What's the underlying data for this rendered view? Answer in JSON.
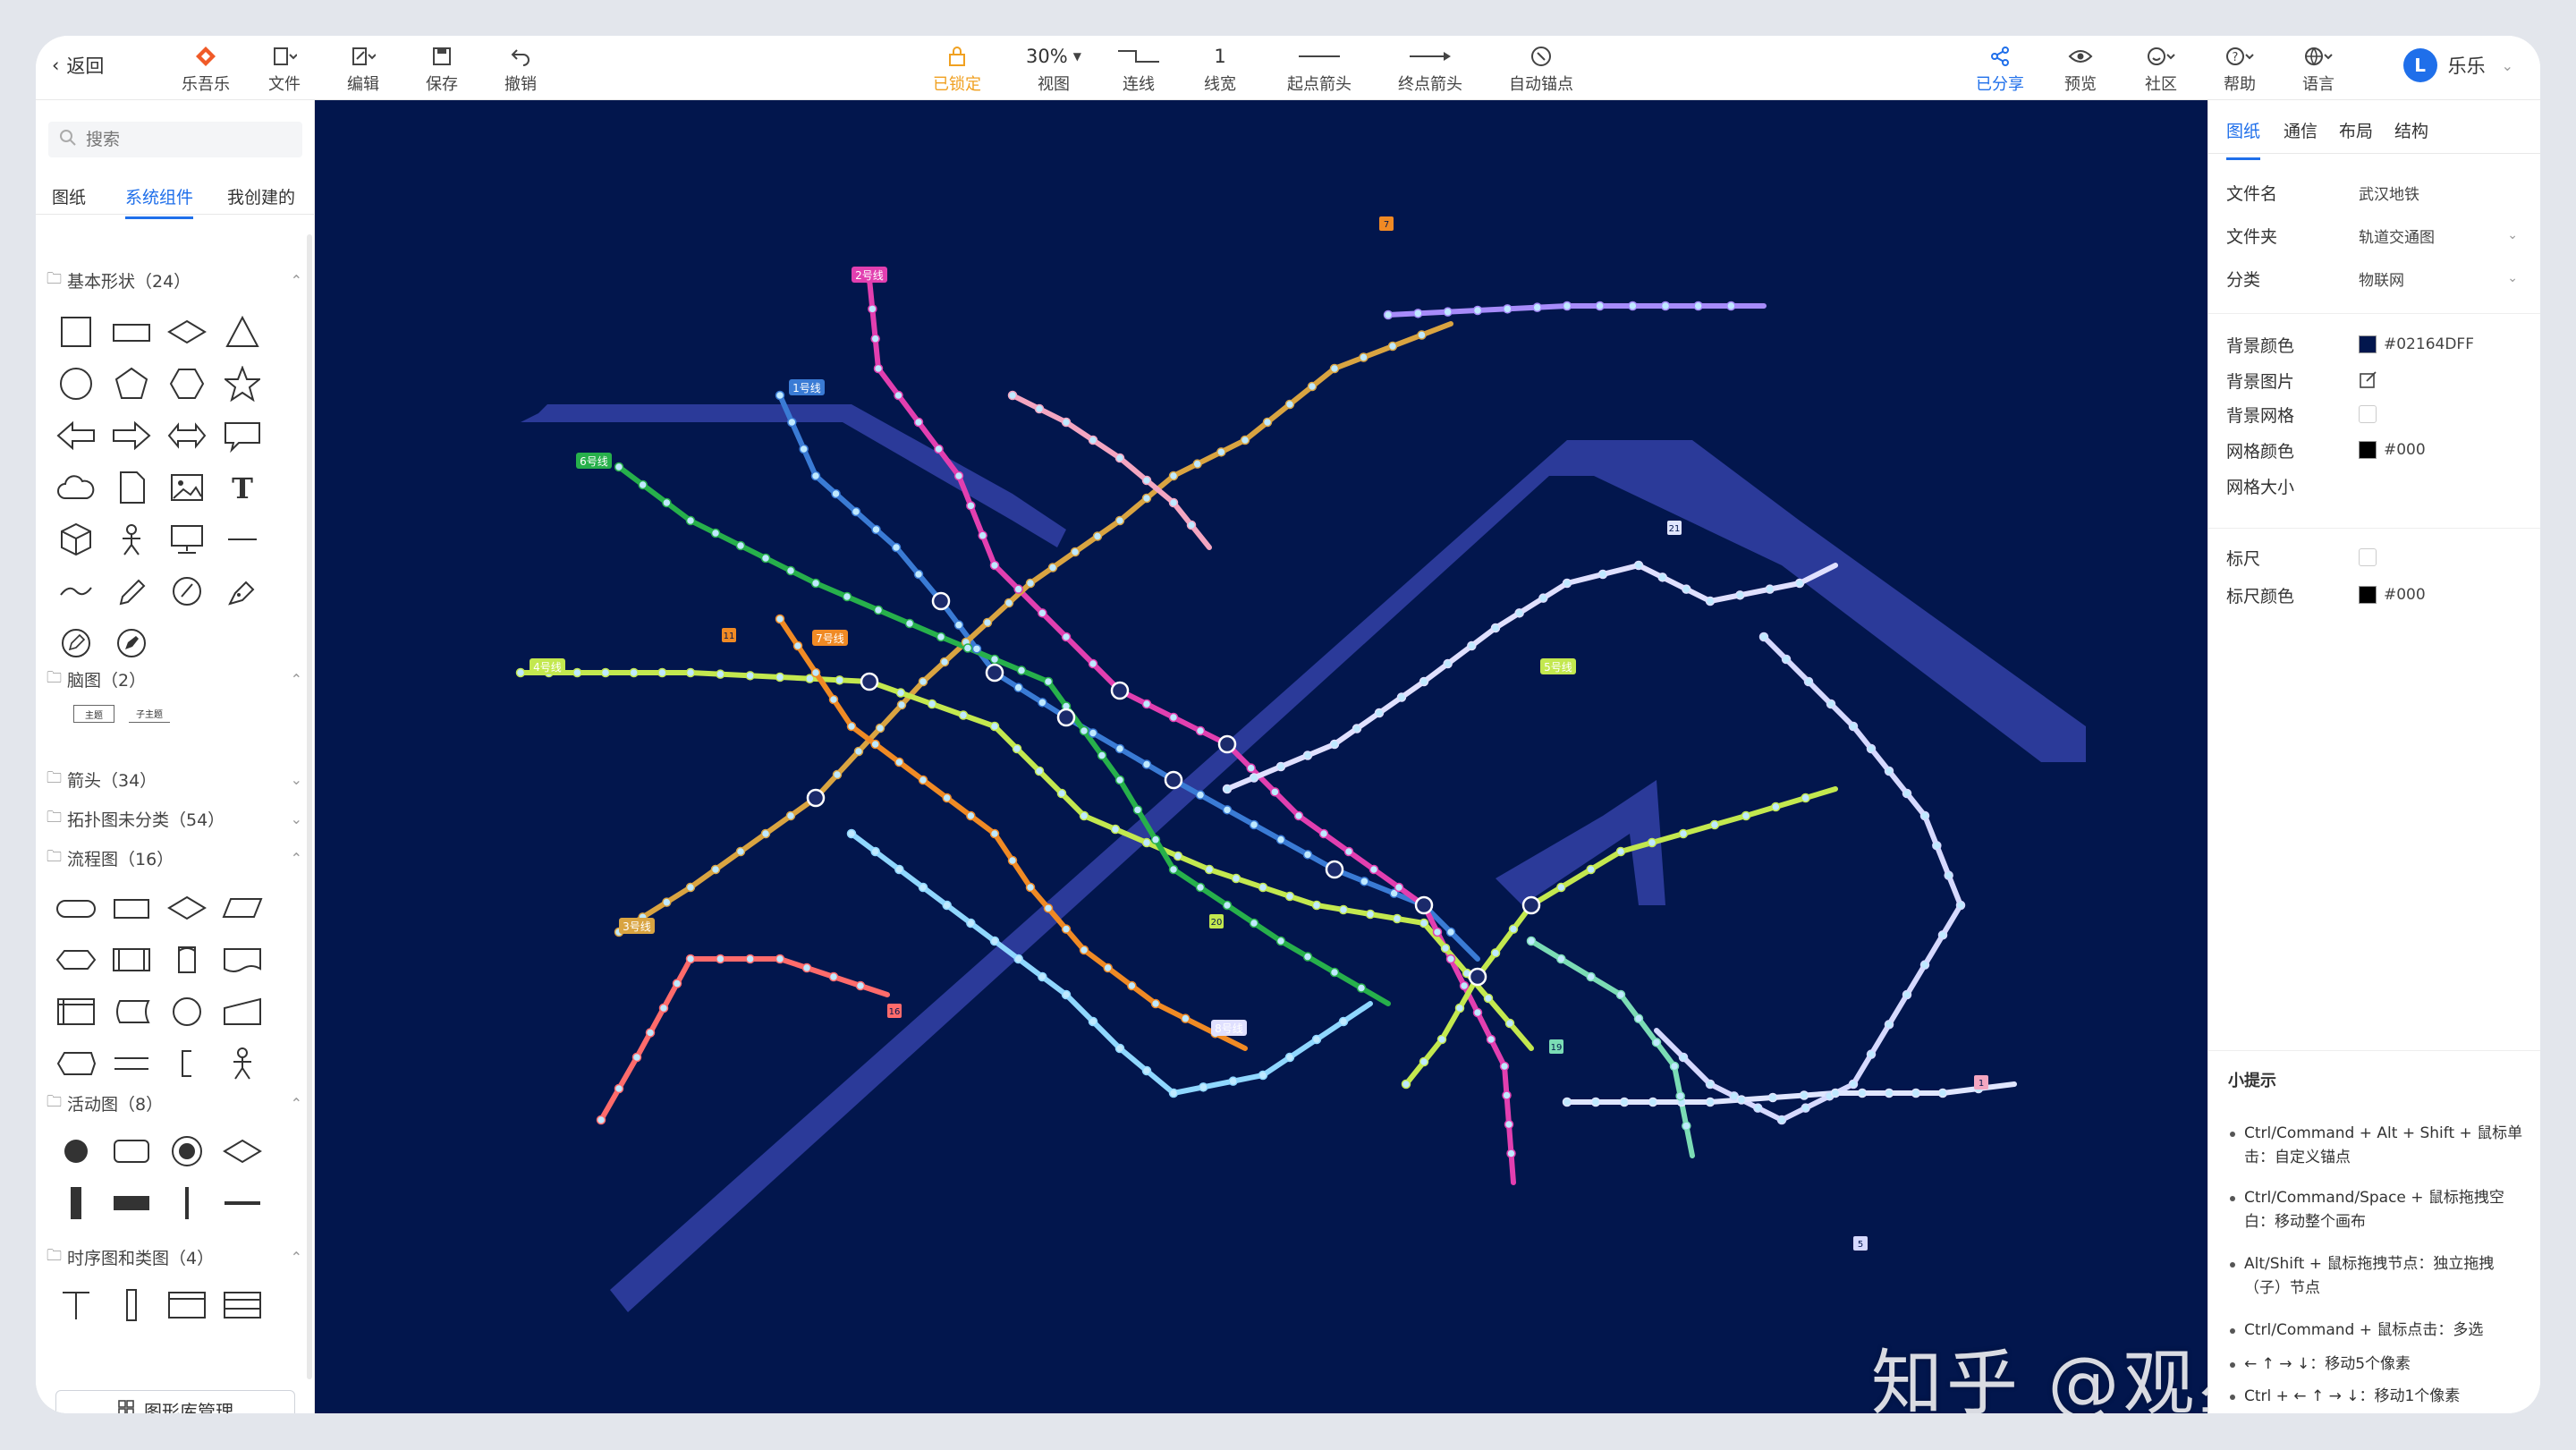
{
  "toolbar": {
    "back_label": "返回",
    "items": [
      {
        "key": "app",
        "label": "乐吾乐",
        "icon": "logo-icon"
      },
      {
        "key": "file",
        "label": "文件",
        "icon": "file-icon"
      },
      {
        "key": "edit",
        "label": "编辑",
        "icon": "edit-icon"
      },
      {
        "key": "save",
        "label": "保存",
        "icon": "save-icon"
      },
      {
        "key": "undo",
        "label": "撤销",
        "icon": "undo-icon"
      },
      {
        "key": "lock",
        "label": "已锁定",
        "icon": "lock-icon"
      },
      {
        "key": "view",
        "label": "视图",
        "value": "30%",
        "icon": "zoom-icon"
      },
      {
        "key": "connector",
        "label": "连线",
        "icon": "connector-icon"
      },
      {
        "key": "linewidth",
        "label": "线宽",
        "value": "1",
        "icon": "line-width-icon"
      },
      {
        "key": "start_arrow",
        "label": "起点箭头",
        "icon": "start-arrow-icon"
      },
      {
        "key": "end_arrow",
        "label": "终点箭头",
        "icon": "end-arrow-icon"
      },
      {
        "key": "auto_anchor",
        "label": "自动锚点",
        "icon": "anchor-icon"
      },
      {
        "key": "share",
        "label": "已分享",
        "icon": "share-icon"
      },
      {
        "key": "preview",
        "label": "预览",
        "icon": "eye-icon"
      },
      {
        "key": "community",
        "label": "社区",
        "icon": "community-icon"
      },
      {
        "key": "help",
        "label": "帮助",
        "icon": "help-icon"
      },
      {
        "key": "language",
        "label": "语言",
        "icon": "globe-icon"
      }
    ],
    "user": {
      "initial": "L",
      "name": "乐乐"
    },
    "accent": "#1f6fea",
    "lock_color": "#f0a020"
  },
  "left_panel": {
    "search_placeholder": "搜索",
    "tabs": [
      "图纸",
      "系统组件",
      "我创建的"
    ],
    "active_tab": "系统组件",
    "groups": [
      {
        "name": "基本形状（24）",
        "expanded": true
      },
      {
        "name": "脑图（2）",
        "expanded": true,
        "items": [
          "主题",
          "子主题"
        ]
      },
      {
        "name": "箭头（34）",
        "expanded": false
      },
      {
        "name": "拓扑图未分类（54）",
        "expanded": false
      },
      {
        "name": "流程图（16）",
        "expanded": true
      },
      {
        "name": "活动图（8）",
        "expanded": true
      },
      {
        "name": "时序图和类图（4）",
        "expanded": true
      }
    ],
    "library_button": "图形库管理"
  },
  "canvas": {
    "background": "#02164D",
    "river_color": "#2b3a99",
    "line_labels": [
      {
        "text": "1号线",
        "color": "#3a7bd5"
      },
      {
        "text": "2号线",
        "color": "#e23fb0"
      },
      {
        "text": "3号线",
        "color": "#d9a441"
      },
      {
        "text": "4号线",
        "color": "#c3e84f"
      },
      {
        "text": "5号线",
        "color": "#c3e84f"
      },
      {
        "text": "6号线",
        "color": "#27b04b"
      },
      {
        "text": "7号线",
        "color": "#f08a24"
      },
      {
        "text": "8号线",
        "color": "#e0e0ff"
      }
    ],
    "station_badges": [
      "7",
      "11",
      "16",
      "19",
      "20",
      "21",
      "1",
      "5"
    ]
  },
  "right_panel": {
    "tabs": [
      "图纸",
      "通信",
      "布局",
      "结构"
    ],
    "active_tab": "图纸",
    "file_name_label": "文件名",
    "file_name": "武汉地铁",
    "folder_label": "文件夹",
    "folder": "轨道交通图",
    "category_label": "分类",
    "category": "物联网",
    "bg_color_label": "背景颜色",
    "bg_color": "#02164DFF",
    "bg_image_label": "背景图片",
    "bg_grid_label": "背景网格",
    "grid_color_label": "网格颜色",
    "grid_color": "#000",
    "grid_size_label": "网格大小",
    "ruler_label": "标尺",
    "ruler_color_label": "标尺颜色",
    "ruler_color": "#000",
    "tips_title": "小提示",
    "tips": [
      "Ctrl/Command + Alt + Shift + 鼠标单击：自定义锚点",
      "Ctrl/Command/Space + 鼠标拖拽空白：移动整个画布",
      "Alt/Shift + 鼠标拖拽节点：独立拖拽（子）节点",
      "Ctrl/Command + 鼠标点击：多选",
      "← ↑ → ↓：移动5个像素",
      "Ctrl + ← ↑ → ↓：移动1个像素"
    ]
  },
  "watermark": "知乎 @观星"
}
